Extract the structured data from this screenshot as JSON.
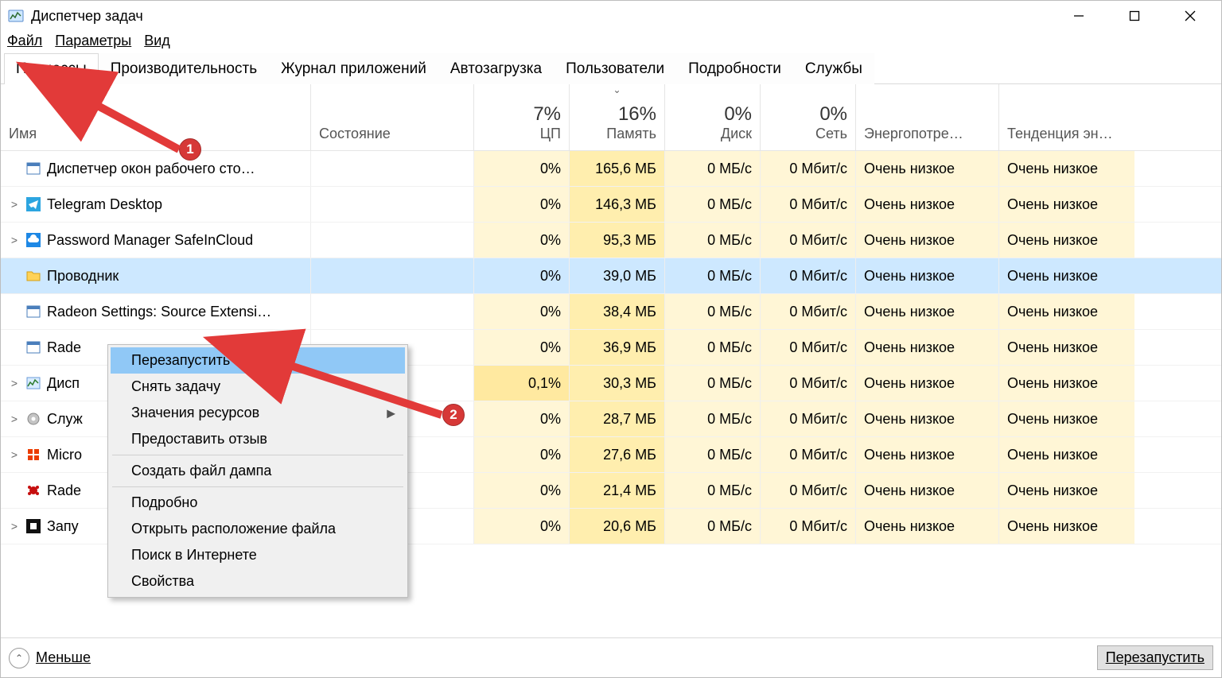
{
  "window": {
    "title": "Диспетчер задач"
  },
  "menu": {
    "file": "Файл",
    "options": "Параметры",
    "view": "Вид"
  },
  "tabs": {
    "processes": "Процессы",
    "performance": "Производительность",
    "app_history": "Журнал приложений",
    "startup": "Автозагрузка",
    "users": "Пользователи",
    "details": "Подробности",
    "services": "Службы"
  },
  "columns": {
    "name": "Имя",
    "status": "Состояние",
    "cpu_pct": "7%",
    "cpu_lbl": "ЦП",
    "mem_pct": "16%",
    "mem_lbl": "Память",
    "disk_pct": "0%",
    "disk_lbl": "Диск",
    "net_pct": "0%",
    "net_lbl": "Сеть",
    "power": "Энергопотре…",
    "power_trend": "Тенденция эн…"
  },
  "rows": [
    {
      "exp": "",
      "icon": "window",
      "name": "Диспетчер окон рабочего сто…",
      "cpu": "0%",
      "mem": "165,6 МБ",
      "disk": "0 МБ/с",
      "net": "0 Мбит/с",
      "pwr": "Очень низкое",
      "trend": "Очень низкое"
    },
    {
      "exp": ">",
      "icon": "telegram",
      "name": "Telegram Desktop",
      "cpu": "0%",
      "mem": "146,3 МБ",
      "disk": "0 МБ/с",
      "net": "0 Мбит/с",
      "pwr": "Очень низкое",
      "trend": "Очень низкое"
    },
    {
      "exp": ">",
      "icon": "cloud",
      "name": "Password Manager SafeInCloud",
      "cpu": "0%",
      "mem": "95,3 МБ",
      "disk": "0 МБ/с",
      "net": "0 Мбит/с",
      "pwr": "Очень низкое",
      "trend": "Очень низкое"
    },
    {
      "exp": "",
      "icon": "folder",
      "name": "Проводник",
      "sel": true,
      "cpu": "0%",
      "mem": "39,0 МБ",
      "disk": "0 МБ/с",
      "net": "0 Мбит/с",
      "pwr": "Очень низкое",
      "trend": "Очень низкое"
    },
    {
      "exp": "",
      "icon": "window",
      "name": "Radeon Settings: Source Extensi…",
      "cpu": "0%",
      "mem": "38,4 МБ",
      "disk": "0 МБ/с",
      "net": "0 Мбит/с",
      "pwr": "Очень низкое",
      "trend": "Очень низкое"
    },
    {
      "exp": "",
      "icon": "window",
      "name": "Rade",
      "cpu": "0%",
      "mem": "36,9 МБ",
      "disk": "0 МБ/с",
      "net": "0 Мбит/с",
      "pwr": "Очень низкое",
      "trend": "Очень низкое"
    },
    {
      "exp": ">",
      "icon": "taskmgr",
      "name": "Дисп",
      "cpu_hi": true,
      "cpu": "0,1%",
      "mem": "30,3 МБ",
      "disk": "0 МБ/с",
      "net": "0 Мбит/с",
      "pwr": "Очень низкое",
      "trend": "Очень низкое"
    },
    {
      "exp": ">",
      "icon": "gear",
      "name": "Служ",
      "cpu": "0%",
      "mem": "28,7 МБ",
      "disk": "0 МБ/с",
      "net": "0 Мбит/с",
      "pwr": "Очень низкое",
      "trend": "Очень низкое"
    },
    {
      "exp": ">",
      "icon": "office",
      "name": "Micro",
      "cpu": "0%",
      "mem": "27,6 МБ",
      "disk": "0 МБ/с",
      "net": "0 Мбит/с",
      "pwr": "Очень низкое",
      "trend": "Очень низкое"
    },
    {
      "exp": "",
      "icon": "radeon",
      "name": "Rade",
      "cpu": "0%",
      "mem": "21,4 МБ",
      "disk": "0 МБ/с",
      "net": "0 Мбит/с",
      "pwr": "Очень низкое",
      "trend": "Очень низкое"
    },
    {
      "exp": ">",
      "icon": "square",
      "name": "Запу",
      "cpu": "0%",
      "mem": "20,6 МБ",
      "disk": "0 МБ/с",
      "net": "0 Мбит/с",
      "pwr": "Очень низкое",
      "trend": "Очень низкое"
    }
  ],
  "context_menu": {
    "restart": "Перезапустить",
    "end_task": "Снять задачу",
    "resource_values": "Значения ресурсов",
    "feedback": "Предоставить отзыв",
    "create_dump": "Создать файл дампа",
    "details": "Подробно",
    "open_location": "Открыть расположение файла",
    "search_online": "Поиск в Интернете",
    "properties": "Свойства"
  },
  "footer": {
    "less": "Меньше",
    "restart_btn": "Перезапустить"
  },
  "annotations": {
    "badge1": "1",
    "badge2": "2"
  }
}
